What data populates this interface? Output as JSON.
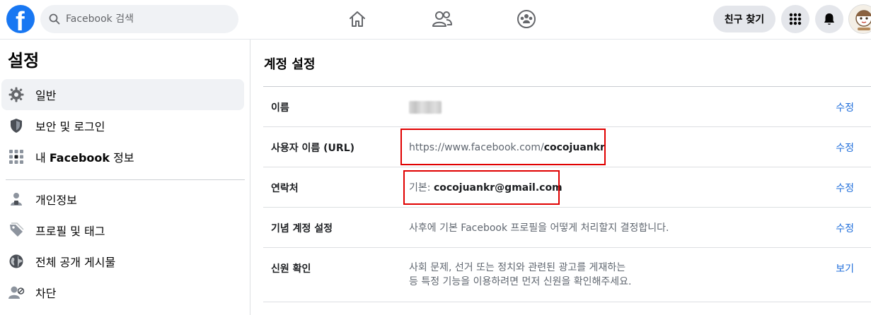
{
  "topbar": {
    "search_placeholder": "Facebook 검색",
    "find_friends_label": "친구 찾기",
    "nav": [
      "home-icon",
      "friends-icon",
      "groups-icon"
    ]
  },
  "sidebar": {
    "title": "설정",
    "items": [
      {
        "label": "일반",
        "icon": "gear-icon",
        "active": true
      },
      {
        "label": "보안 및 로그인",
        "icon": "shield-icon",
        "active": false
      },
      {
        "label_prefix": "내 ",
        "label_bold": "Facebook",
        "label_suffix": " 정보",
        "icon": "facebook-info-icon",
        "active": false
      },
      {
        "label": "개인정보",
        "icon": "lock-person-icon",
        "active": false
      },
      {
        "label": "프로필 및 태그",
        "icon": "tag-icon",
        "active": false
      },
      {
        "label": "전체 공개 게시물",
        "icon": "globe-icon",
        "active": false
      },
      {
        "label": "차단",
        "icon": "block-user-icon",
        "active": false
      }
    ]
  },
  "main": {
    "title": "계정 설정",
    "rows": [
      {
        "label": "이름",
        "value": "",
        "action": "수정"
      },
      {
        "label": "사용자 이름 (URL)",
        "value_prefix": "https://www.facebook.com/",
        "value_bold": "cocojuankr",
        "action": "수정"
      },
      {
        "label": "연락처",
        "value_prefix": "기본: ",
        "value_bold": "cocojuankr@gmail.com",
        "action": "수정"
      },
      {
        "label": "기념 계정 설정",
        "value": "사후에 기본 Facebook 프로필을 어떻게 처리할지 결정합니다.",
        "action": "수정"
      },
      {
        "label": "신원 확인",
        "value_line1": "사회 문제, 선거 또는 정치와 관련된 광고를 게재하는",
        "value_line2": "등 특정 기능을 이용하려면 먼저 신원을 확인해주세요.",
        "action": "보기"
      }
    ]
  },
  "colors": {
    "brand": "#1877f2",
    "link": "#216fdb",
    "highlight_box": "#e00000"
  }
}
